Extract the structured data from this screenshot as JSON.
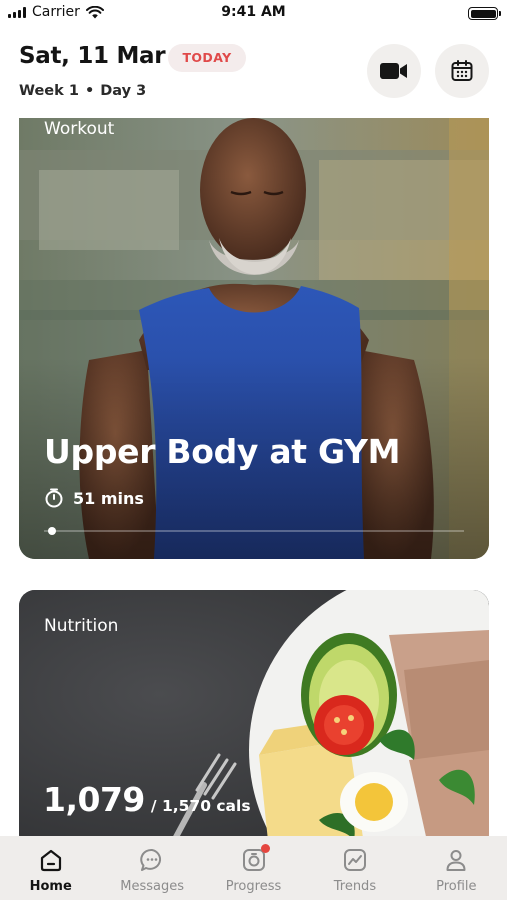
{
  "status_bar": {
    "carrier": "Carrier",
    "time": "9:41 AM"
  },
  "header": {
    "date": "Sat, 11 Mar",
    "today_badge": "TODAY",
    "week": "Week 1",
    "separator": "•",
    "day": "Day 3"
  },
  "workout": {
    "section_label": "Workout",
    "title": "Upper Body at GYM",
    "duration": "51 mins",
    "progress_fraction": 0.01
  },
  "nutrition": {
    "section_label": "Nutrition",
    "calories_consumed": "1,079",
    "calories_goal": "/ 1,570 cals"
  },
  "tabs": [
    {
      "label": "Home",
      "icon": "home-icon",
      "active": true
    },
    {
      "label": "Messages",
      "icon": "messages-icon",
      "active": false
    },
    {
      "label": "Progress",
      "icon": "progress-icon",
      "active": false,
      "badge": true
    },
    {
      "label": "Trends",
      "icon": "trends-icon",
      "active": false
    },
    {
      "label": "Profile",
      "icon": "profile-icon",
      "active": false
    }
  ],
  "colors": {
    "accent_red": "#e04a4a",
    "today_badge_bg": "#f4ecec",
    "tab_bar_bg": "#efedeb",
    "tab_inactive": "#8c8c8c",
    "tab_active": "#141414"
  }
}
